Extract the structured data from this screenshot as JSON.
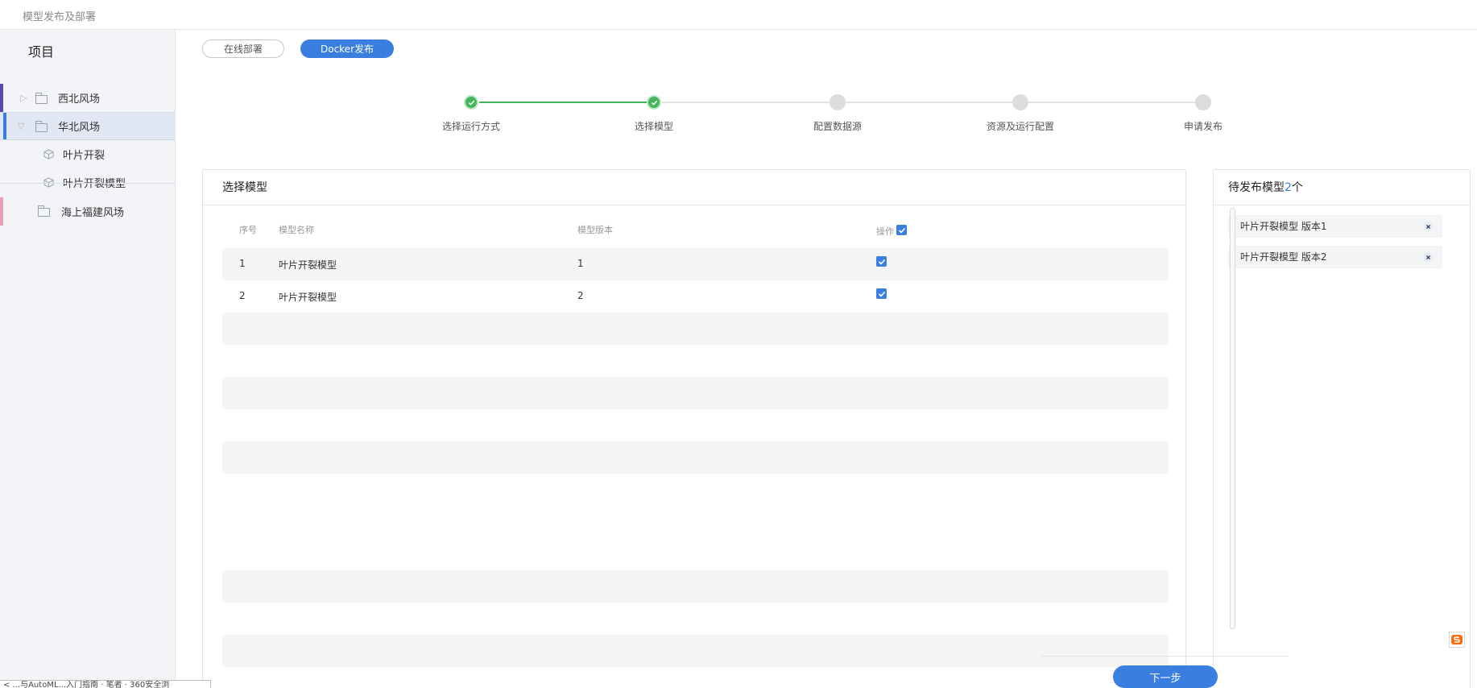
{
  "header": {
    "title": "模型发布及部署"
  },
  "sidebar": {
    "heading": "项目",
    "tree": [
      {
        "label": "西北风场",
        "expanded": false,
        "accent": "#5b4aa8"
      },
      {
        "label": "华北风场",
        "expanded": true,
        "accent": "#3a7fe0"
      },
      {
        "label": "叶片开裂"
      },
      {
        "label": "叶片开裂模型"
      },
      {
        "label": "海上福建风场",
        "accent": "#e8a0b4"
      }
    ]
  },
  "modes": {
    "online": "在线部署",
    "docker": "Docker发布"
  },
  "steps": [
    {
      "label": "选择运行方式",
      "status": "done"
    },
    {
      "label": "选择模型",
      "status": "done"
    },
    {
      "label": "配置数据源",
      "status": "todo"
    },
    {
      "label": "资源及运行配置",
      "status": "todo"
    },
    {
      "label": "申请发布",
      "status": "todo"
    }
  ],
  "model_panel": {
    "title": "选择模型",
    "columns": {
      "index": "序号",
      "name": "模型名称",
      "version": "模型版本",
      "action": "操作"
    },
    "rows": [
      {
        "index": "1",
        "name": "叶片开裂模型",
        "version": "1",
        "checked": true
      },
      {
        "index": "2",
        "name": "叶片开裂模型",
        "version": "2",
        "checked": true
      }
    ]
  },
  "pending_panel": {
    "title_prefix": "待发布模型",
    "count": "2",
    "title_suffix": "个",
    "items": [
      {
        "label": "叶片开裂模型 版本1"
      },
      {
        "label": "叶片开裂模型 版本2"
      }
    ]
  },
  "next_button": "下一步",
  "status_strip": "< ...与AutoML...入门指南 · 笔者 · 360安全浏",
  "colors": {
    "primary": "#3a7fe0",
    "success": "#44b55a"
  }
}
